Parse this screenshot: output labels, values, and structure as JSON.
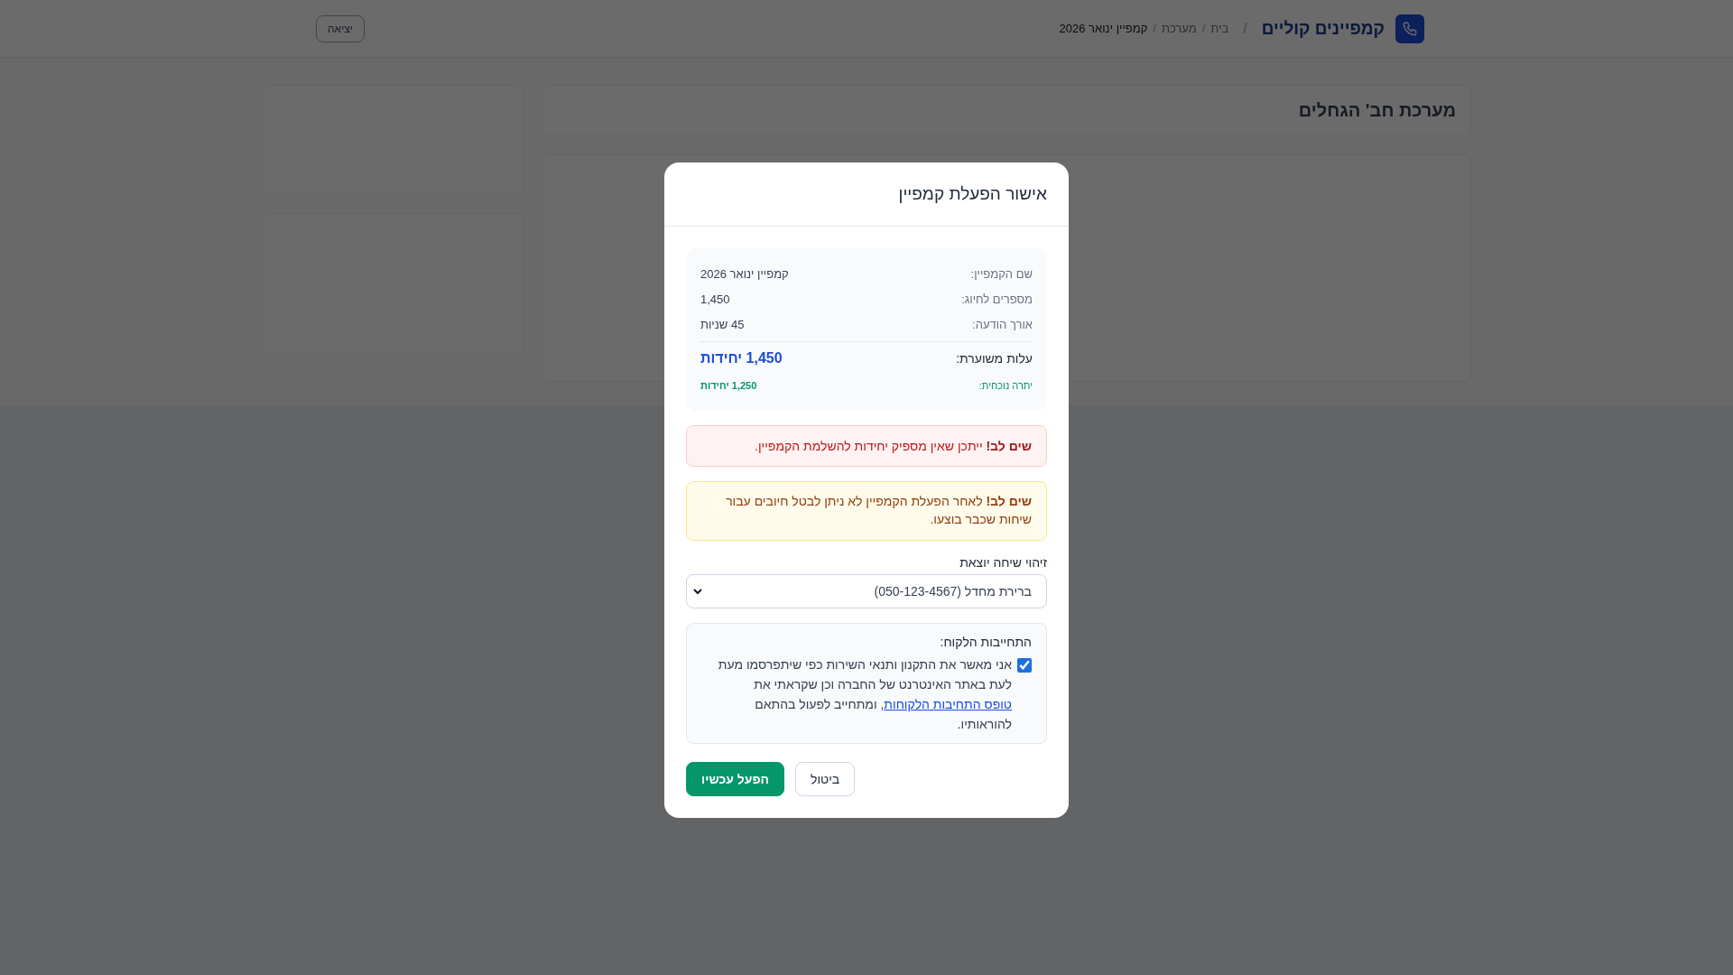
{
  "header": {
    "brand": "קמפיינים קוליים",
    "divider": "/",
    "breadcrumbs": [
      {
        "label": "בית",
        "current": false
      },
      {
        "label": "מערכת",
        "current": false
      },
      {
        "label": "קמפיין ינואר 2026",
        "current": true
      }
    ],
    "separator": "/",
    "logout_button": "יציאה"
  },
  "page": {
    "title": "מערכת חב' הגחלים"
  },
  "modal": {
    "title": "אישור הפעלת קמפיין",
    "summary": [
      {
        "label": "שם הקמפיין:",
        "value": "קמפיין ינואר 2026"
      },
      {
        "label": "מספרים לחיוג:",
        "value": "1,450"
      },
      {
        "label": "אורך הודעה:",
        "value": "45 שניות"
      }
    ],
    "cost": {
      "label": "עלות משוערת:",
      "value": "1,450 יחידות"
    },
    "balance": {
      "label": "יתרה נוכחית:",
      "value": "1,250 יחידות"
    },
    "alerts": [
      {
        "kind": "danger",
        "text": "**שים לב!** ייתכן שאין מספיק יחידות להשלמת הקמפיין."
      },
      {
        "kind": "warning",
        "text": "**שים לב!** לאחר הפעלת הקמפיין לא ניתן לבטל חיובים עבור שיחות שכבר בוצעו."
      }
    ],
    "caller_id": {
      "label": "זיהוי שיחה יוצאת",
      "value": "ברירת מחדל (050-123-4567)"
    },
    "commitment": {
      "title": "התחייבות הלקוח:",
      "checked": true,
      "text_before": "אני מאשר את התקנון ותנאי השירות כפי שיתפרסמו מעת לעת באתר האינטרנט של החברה וכן שקראתי את ",
      "link": "טופס התחיבות הלקוחות",
      "text_after": ", ומתחייב לפעול בהתאם להוראותיו."
    },
    "buttons": [
      {
        "label": "ביטול",
        "kind": "secondary"
      },
      {
        "label": "הפעל עכשיו",
        "kind": "primary"
      }
    ]
  }
}
